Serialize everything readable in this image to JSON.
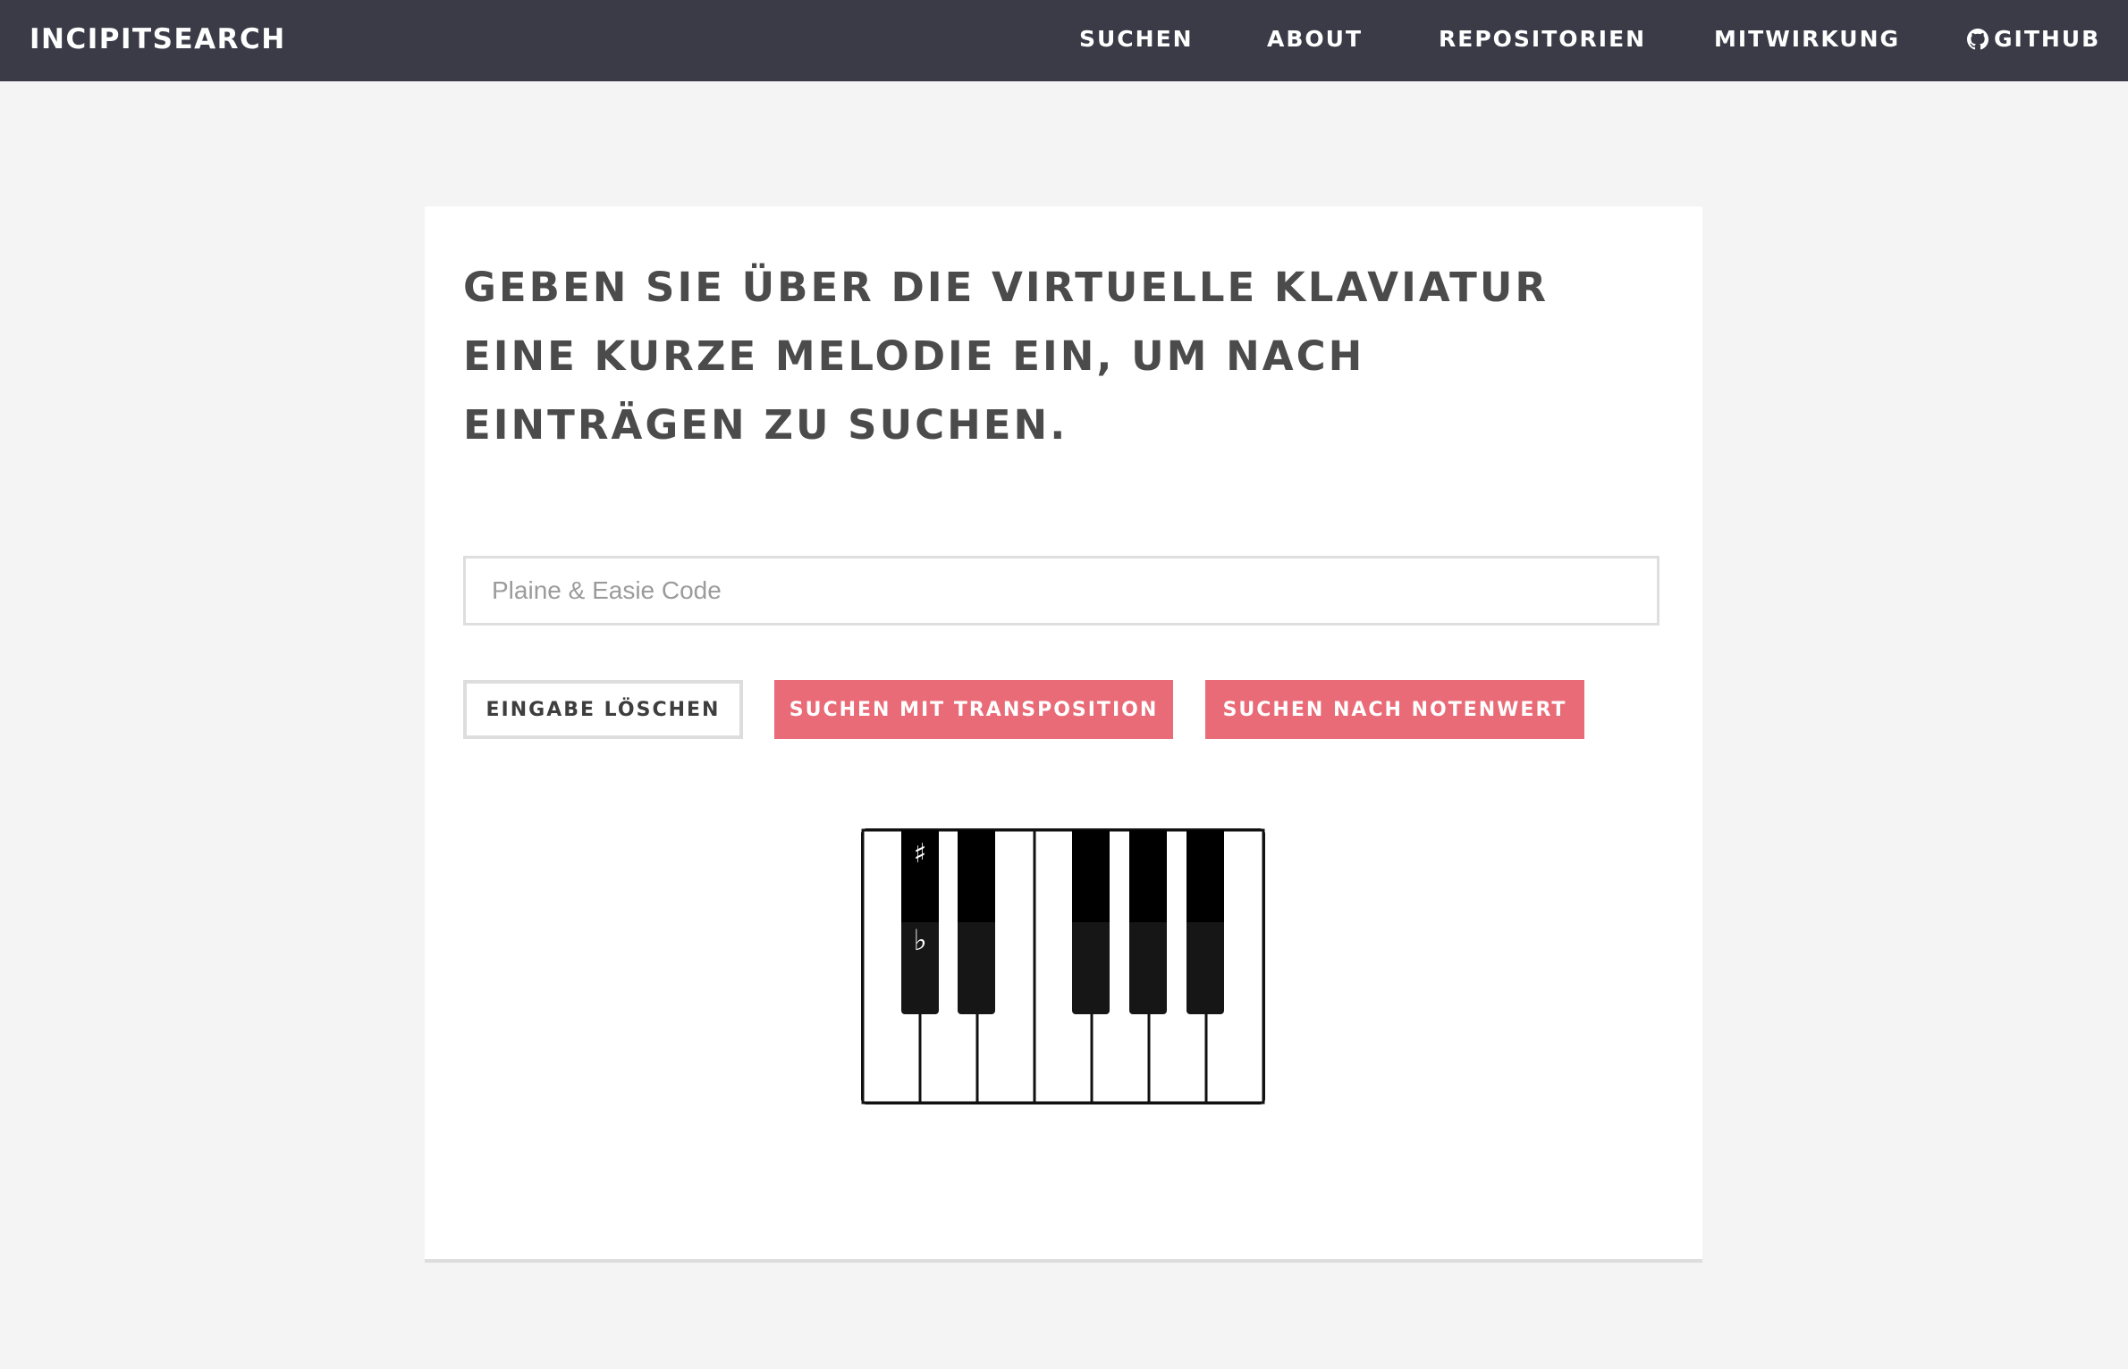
{
  "header": {
    "brand": "INCIPITSEARCH",
    "nav": {
      "suchen": "SUCHEN",
      "about": "ABOUT",
      "repositorien": "REPOSITORIEN",
      "mitwirkung": "MITWIRKUNG",
      "github": "GITHUB"
    },
    "github_icon": "github-icon",
    "background_color": "#3a3b47"
  },
  "main": {
    "headline": "GEBEN SIE ÜBER DIE VIRTUELLE KLAVIATUR EINE KURZE MELODIE EIN, UM NACH EINTRÄGEN ZU SUCHEN.",
    "input": {
      "placeholder": "Plaine & Easie Code",
      "value": ""
    },
    "buttons": {
      "clear": "EINGABE LÖSCHEN",
      "transpose": "SUCHEN MIT TRANSPOSITION",
      "duration": "SUCHEN NACH NOTENWERT"
    },
    "accent_color": "#e96b77"
  },
  "keyboard": {
    "white_keys": [
      "C",
      "D",
      "E",
      "F",
      "G",
      "A",
      "B"
    ],
    "black_keys": [
      "C#",
      "D#",
      "F#",
      "G#",
      "A#"
    ],
    "sharp_symbol": "♯",
    "flat_symbol": "♭"
  }
}
